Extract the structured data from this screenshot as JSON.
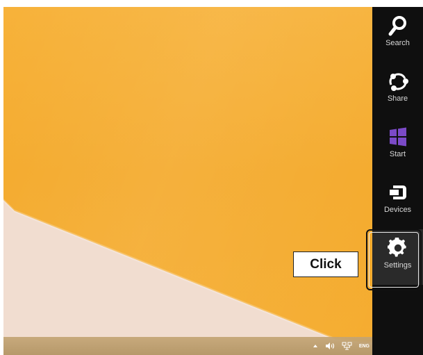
{
  "charms": {
    "search": {
      "label": "Search",
      "icon": "search-icon"
    },
    "share": {
      "label": "Share",
      "icon": "share-icon"
    },
    "start": {
      "label": "Start",
      "icon": "windows-start-icon",
      "icon_color": "#7b4ac7"
    },
    "devices": {
      "label": "Devices",
      "icon": "devices-icon"
    },
    "settings": {
      "label": "Settings",
      "icon": "gear-icon"
    }
  },
  "callout": {
    "label": "Click",
    "target": "Settings"
  },
  "taskbar": {
    "tray": {
      "chevron_icon": "chevron-up-icon",
      "volume_icon": "volume-icon",
      "network_icon": "network-icon",
      "language": "ENG"
    }
  },
  "colors": {
    "charms_bar": "#0f0f0f",
    "settings_hover": "#2a2a2a",
    "wallpaper_orange": "#f6ad2f",
    "wallpaper_light": "#f1ddd0",
    "taskbar": "#c4a575"
  }
}
